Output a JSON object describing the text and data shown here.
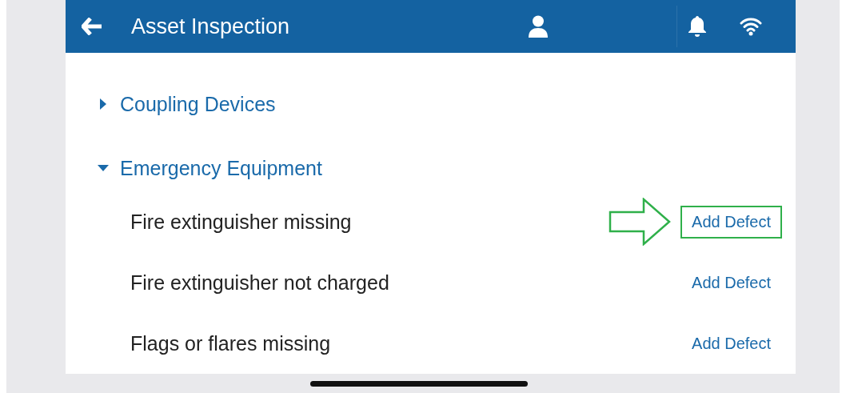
{
  "header": {
    "title": "Asset Inspection"
  },
  "sections": [
    {
      "title": "Coupling Devices",
      "expanded": false
    },
    {
      "title": "Emergency Equipment",
      "expanded": true,
      "items": [
        {
          "label": "Fire extinguisher missing",
          "action": "Add Defect",
          "highlighted": true
        },
        {
          "label": "Fire extinguisher not charged",
          "action": "Add Defect",
          "highlighted": false
        },
        {
          "label": "Flags or flares missing",
          "action": "Add Defect",
          "highlighted": false
        }
      ]
    }
  ]
}
